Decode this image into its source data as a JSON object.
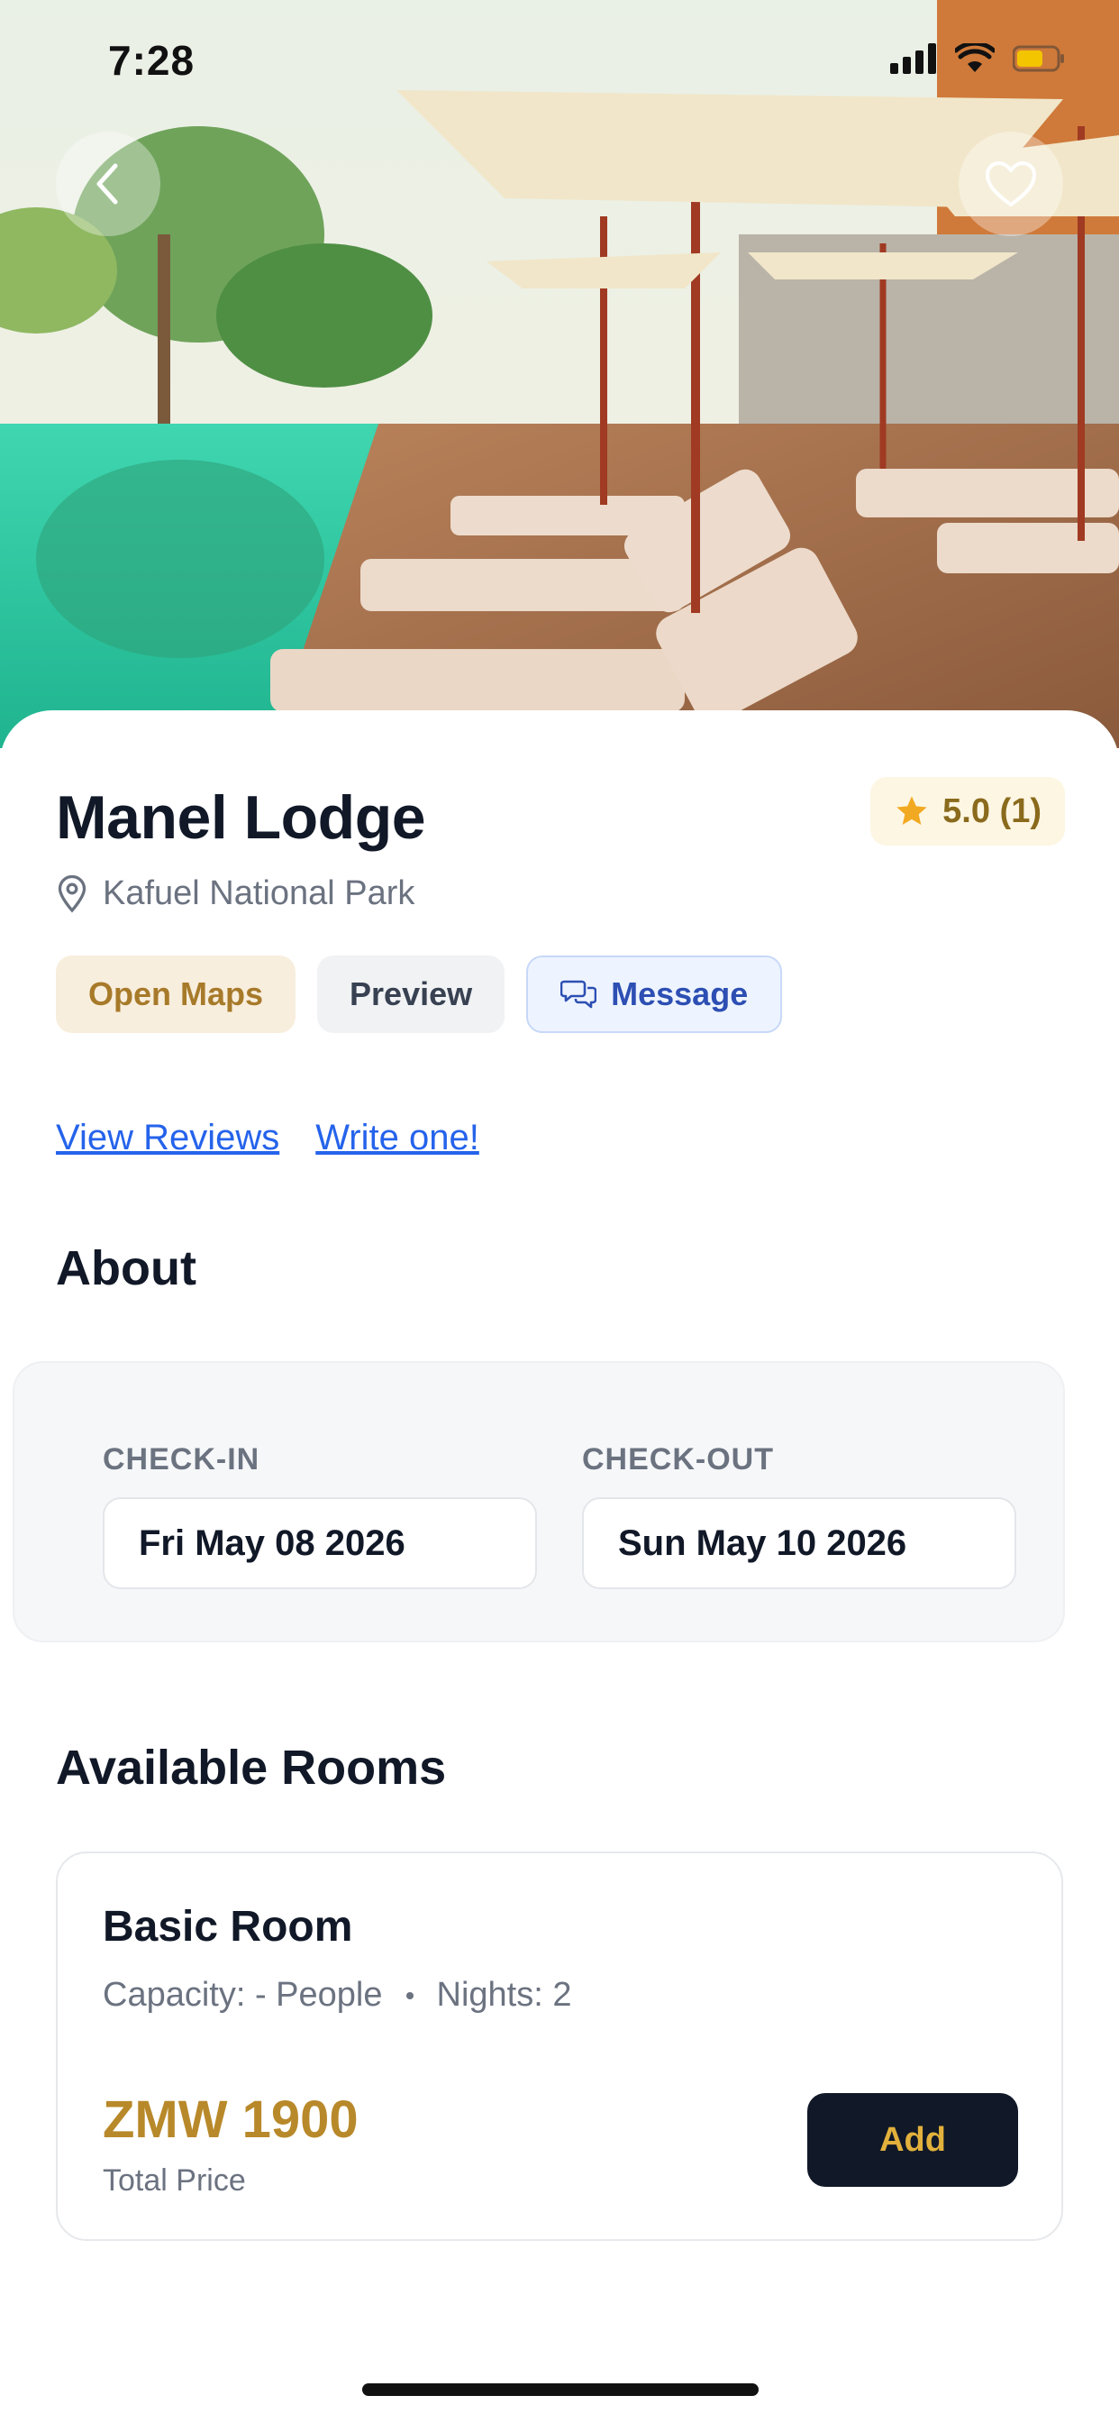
{
  "status_bar": {
    "time": "7:28"
  },
  "lodge": {
    "name": "Manel Lodge",
    "location": "Kafuel National Park",
    "rating": "5.0 (1)"
  },
  "actions": {
    "open_maps": "Open Maps",
    "preview": "Preview",
    "message": "Message"
  },
  "reviews": {
    "view": "View Reviews",
    "write": "Write one!"
  },
  "about": {
    "title": "About"
  },
  "dates": {
    "checkin_label": "CHECK-IN",
    "checkin_value": "Fri May 08 2026",
    "checkout_label": "CHECK-OUT",
    "checkout_value": "Sun May 10 2026"
  },
  "rooms": {
    "title": "Available Rooms",
    "items": [
      {
        "name": "Basic Room",
        "capacity": "Capacity: - People",
        "nights": "Nights: 2",
        "price": "ZMW 1900",
        "price_label": "Total Price",
        "add_label": "Add"
      }
    ]
  },
  "colors": {
    "accent_gold": "#b8892a",
    "link_blue": "#2563eb",
    "dark_button": "#111827"
  }
}
